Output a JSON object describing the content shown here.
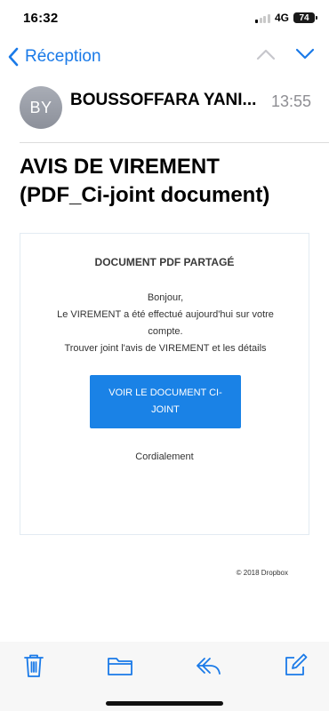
{
  "status_bar": {
    "time": "16:32",
    "network": "4G",
    "battery": "74"
  },
  "nav": {
    "back_label": "Réception"
  },
  "message": {
    "avatar_initials": "BY",
    "sender": "BOUSSOFFARA YANI...",
    "time": "13:55",
    "subject_line1": "AVIS DE VIREMENT",
    "subject_line2": "(PDF_Ci-joint document)"
  },
  "email_card": {
    "title": "DOCUMENT PDF PARTAGÉ",
    "greeting": "Bonjour,",
    "body_line1": "Le VIREMENT a été effectué aujourd'hui sur votre",
    "body_line2": "compte.",
    "body_line3": "Trouver joint l'avis de VIREMENT et les détails",
    "button_label": "VOIR LE DOCUMENT CI-JOINT",
    "closing": "Cordialement",
    "accent_color": "#1a82e6"
  },
  "footer": {
    "copyright": "© 2018 Dropbox"
  },
  "toolbar": {
    "icons": [
      "trash-icon",
      "folder-icon",
      "reply-icon",
      "compose-icon"
    ],
    "tint": "#1a7ae8"
  }
}
